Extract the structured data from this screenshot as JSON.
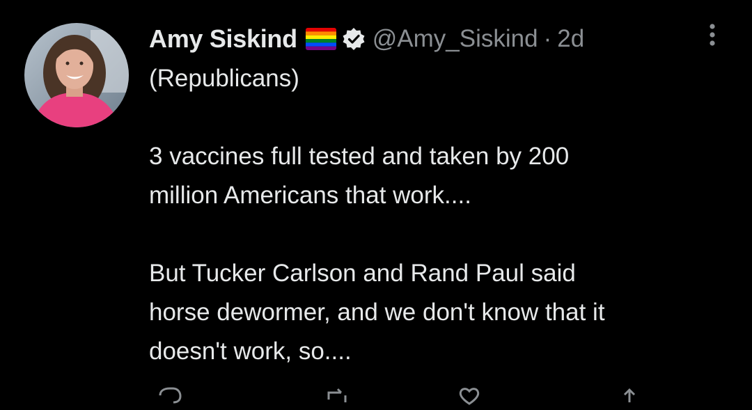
{
  "tweet": {
    "author_name": "Amy Siskind",
    "handle": "@Amy_Siskind",
    "separator": "·",
    "time": "2d",
    "lines": [
      "(Republicans)",
      "",
      "3 vaccines full tested and taken by 200",
      "million Americans that work....",
      "",
      "But Tucker Carlson and Rand Paul said",
      "horse dewormer, and we don't know that it",
      "doesn't work, so...."
    ]
  },
  "icons": {
    "flag": "rainbow-flag-icon",
    "verified": "verified-badge-icon",
    "more": "more-options-icon",
    "reply": "reply-icon",
    "retweet": "retweet-icon",
    "like": "like-icon",
    "share": "share-icon"
  },
  "colors": {
    "background": "#000000",
    "text": "#e7e9ea",
    "secondary": "#8b8f93",
    "avatar_shirt": "#e8407f"
  }
}
